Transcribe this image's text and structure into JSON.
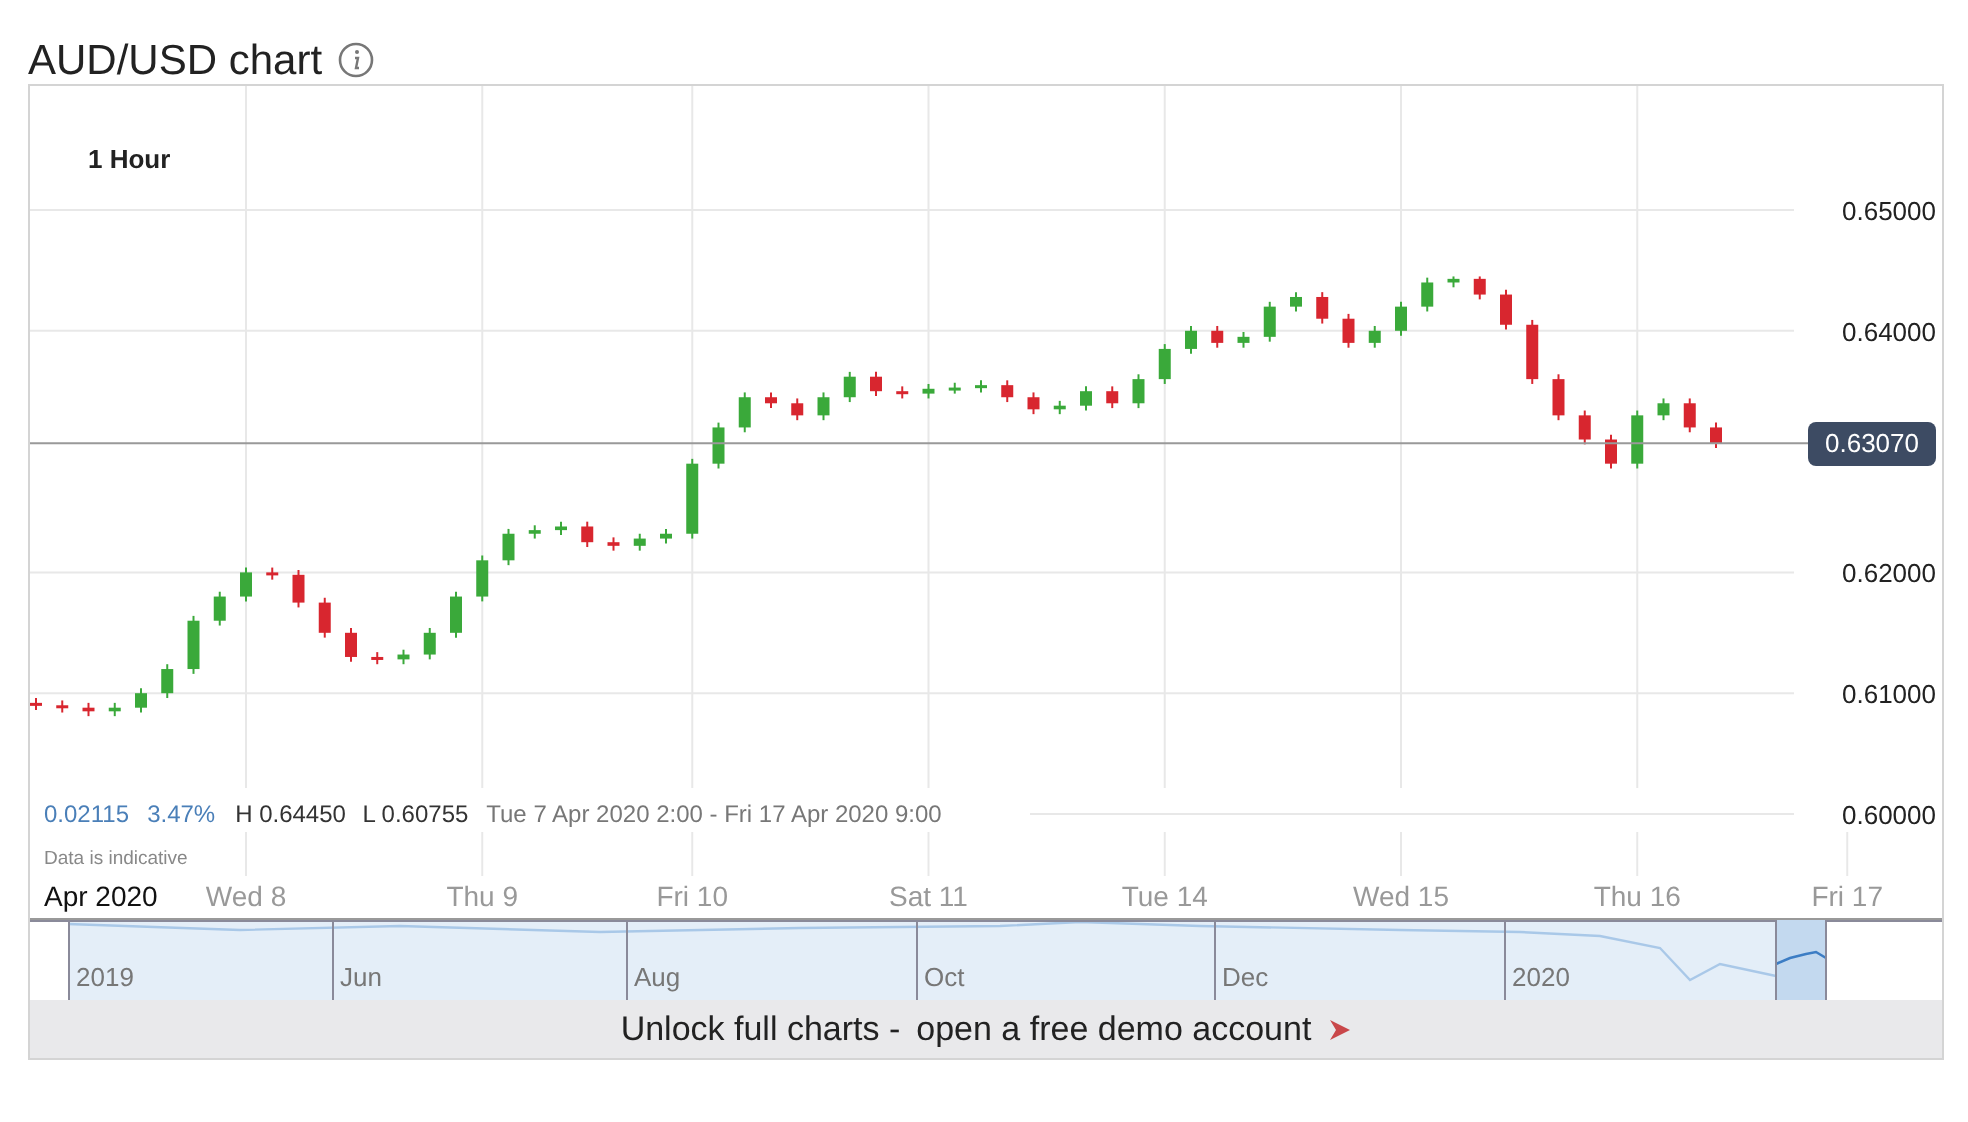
{
  "title": "AUD/USD chart",
  "chart": {
    "stats": [
      {
        "text": "0.02115",
        "kind": "change"
      },
      {
        "text": "3.47%",
        "kind": "change"
      },
      {
        "text": "H 0.64450",
        "kind": "plain"
      },
      {
        "text": "L 0.60755",
        "kind": "plain"
      },
      {
        "text": "Tue 7 Apr 2020 2:00 - Fri 17 Apr 2020 9:00",
        "kind": "range"
      }
    ],
    "note": "Data is indicative",
    "chart_data": {
      "type": "candlestick",
      "title": "1 Hour",
      "grid": true,
      "categories": [
        null,
        null,
        "Apr 2020",
        null,
        null,
        null,
        null,
        null,
        "Wed 8",
        null,
        null,
        null,
        null,
        null,
        null,
        null,
        null,
        "Thu 9",
        null,
        null,
        null,
        null,
        null,
        null,
        null,
        "Fri 10",
        null,
        null,
        null,
        null,
        null,
        null,
        null,
        null,
        "Sat 11",
        null,
        null,
        null,
        null,
        null,
        null,
        null,
        null,
        "Tue 14",
        null,
        null,
        null,
        null,
        null,
        null,
        null,
        null,
        "Wed 15",
        null,
        null,
        null,
        null,
        null,
        null,
        null,
        null,
        "Thu 16",
        null,
        null,
        null,
        null,
        null,
        null,
        null,
        "Fri 17"
      ],
      "ohlc": [
        [
          0.6092,
          0.6096,
          0.6086,
          0.609
        ],
        [
          0.609,
          0.6094,
          0.6084,
          0.6088
        ],
        [
          0.6088,
          0.6092,
          0.6081,
          0.6085
        ],
        [
          0.6085,
          0.6092,
          0.6081,
          0.6088
        ],
        [
          0.6088,
          0.6104,
          0.6084,
          0.61
        ],
        [
          0.61,
          0.6124,
          0.6096,
          0.612
        ],
        [
          0.612,
          0.6164,
          0.6116,
          0.616
        ],
        [
          0.616,
          0.6184,
          0.6156,
          0.618
        ],
        [
          0.618,
          0.6204,
          0.6176,
          0.62
        ],
        [
          0.62,
          0.6204,
          0.6194,
          0.6198
        ],
        [
          0.6198,
          0.6202,
          0.6171,
          0.6175
        ],
        [
          0.6175,
          0.6179,
          0.6146,
          0.615
        ],
        [
          0.615,
          0.6154,
          0.6126,
          0.613
        ],
        [
          0.613,
          0.6134,
          0.6124,
          0.6128
        ],
        [
          0.6128,
          0.6136,
          0.6124,
          0.6132
        ],
        [
          0.6132,
          0.6154,
          0.6128,
          0.615
        ],
        [
          0.615,
          0.6184,
          0.6146,
          0.618
        ],
        [
          0.618,
          0.6214,
          0.6176,
          0.621
        ],
        [
          0.621,
          0.6236,
          0.6206,
          0.6232
        ],
        [
          0.6232,
          0.6239,
          0.6228,
          0.6235
        ],
        [
          0.6235,
          0.6242,
          0.6231,
          0.6238
        ],
        [
          0.6238,
          0.6242,
          0.6221,
          0.6225
        ],
        [
          0.6225,
          0.6229,
          0.6218,
          0.6222
        ],
        [
          0.6222,
          0.6232,
          0.6218,
          0.6228
        ],
        [
          0.6228,
          0.6236,
          0.6224,
          0.6232
        ],
        [
          0.6232,
          0.6294,
          0.6228,
          0.629
        ],
        [
          0.629,
          0.6324,
          0.6286,
          0.632
        ],
        [
          0.632,
          0.6349,
          0.6316,
          0.6345
        ],
        [
          0.6345,
          0.6349,
          0.6336,
          0.634
        ],
        [
          0.634,
          0.6344,
          0.6326,
          0.633
        ],
        [
          0.633,
          0.6349,
          0.6326,
          0.6345
        ],
        [
          0.6345,
          0.6366,
          0.6341,
          0.6362
        ],
        [
          0.6362,
          0.6366,
          0.6346,
          0.635
        ],
        [
          0.635,
          0.6354,
          0.6344,
          0.6348
        ],
        [
          0.6348,
          0.6356,
          0.6344,
          0.6352
        ],
        [
          0.6352,
          0.6357,
          0.6348,
          0.6353
        ],
        [
          0.6353,
          0.6359,
          0.6349,
          0.6355
        ],
        [
          0.6355,
          0.6359,
          0.6341,
          0.6345
        ],
        [
          0.6345,
          0.6349,
          0.6331,
          0.6335
        ],
        [
          0.6335,
          0.6342,
          0.6331,
          0.6338
        ],
        [
          0.6338,
          0.6354,
          0.6334,
          0.635
        ],
        [
          0.635,
          0.6354,
          0.6336,
          0.634
        ],
        [
          0.634,
          0.6364,
          0.6336,
          0.636
        ],
        [
          0.636,
          0.6389,
          0.6356,
          0.6385
        ],
        [
          0.6385,
          0.6404,
          0.6381,
          0.64
        ],
        [
          0.64,
          0.6404,
          0.6386,
          0.639
        ],
        [
          0.639,
          0.6399,
          0.6386,
          0.6395
        ],
        [
          0.6395,
          0.6424,
          0.6391,
          0.642
        ],
        [
          0.642,
          0.6432,
          0.6416,
          0.6428
        ],
        [
          0.6428,
          0.6432,
          0.6406,
          0.641
        ],
        [
          0.641,
          0.6414,
          0.6386,
          0.639
        ],
        [
          0.639,
          0.6404,
          0.6386,
          0.64
        ],
        [
          0.64,
          0.6424,
          0.6396,
          0.642
        ],
        [
          0.642,
          0.6444,
          0.6416,
          0.644
        ],
        [
          0.644,
          0.6445,
          0.6436,
          0.6443
        ],
        [
          0.6443,
          0.6445,
          0.6426,
          0.643
        ],
        [
          0.643,
          0.6434,
          0.6401,
          0.6405
        ],
        [
          0.6405,
          0.6409,
          0.6356,
          0.636
        ],
        [
          0.636,
          0.6364,
          0.6326,
          0.633
        ],
        [
          0.633,
          0.6334,
          0.6306,
          0.631
        ],
        [
          0.631,
          0.6314,
          0.6286,
          0.629
        ],
        [
          0.629,
          0.6334,
          0.6286,
          0.633
        ],
        [
          0.633,
          0.6344,
          0.6326,
          0.634
        ],
        [
          0.634,
          0.6344,
          0.6316,
          0.632
        ],
        [
          0.632,
          0.6324,
          0.6303,
          0.6307
        ],
        null,
        null,
        null,
        null,
        null
      ],
      "ylim": [
        0.6,
        0.65
      ],
      "yticks": [
        {
          "value": 0.6,
          "label": "0.60000"
        },
        {
          "value": 0.61,
          "label": "0.61000"
        },
        {
          "value": 0.62,
          "label": "0.62000"
        },
        {
          "value": 0.64,
          "label": "0.64000"
        },
        {
          "value": 0.65,
          "label": "0.65000"
        }
      ],
      "ref_lines": [
        {
          "axis": "y",
          "value": 0.6307,
          "label": "0.63070"
        }
      ]
    }
  },
  "navigator": {
    "labels": [
      "2019",
      "Jun",
      "Aug",
      "Oct",
      "Dec",
      "2020"
    ]
  },
  "banner": {
    "text": "Unlock full charts -",
    "link": "open a free demo account"
  }
}
